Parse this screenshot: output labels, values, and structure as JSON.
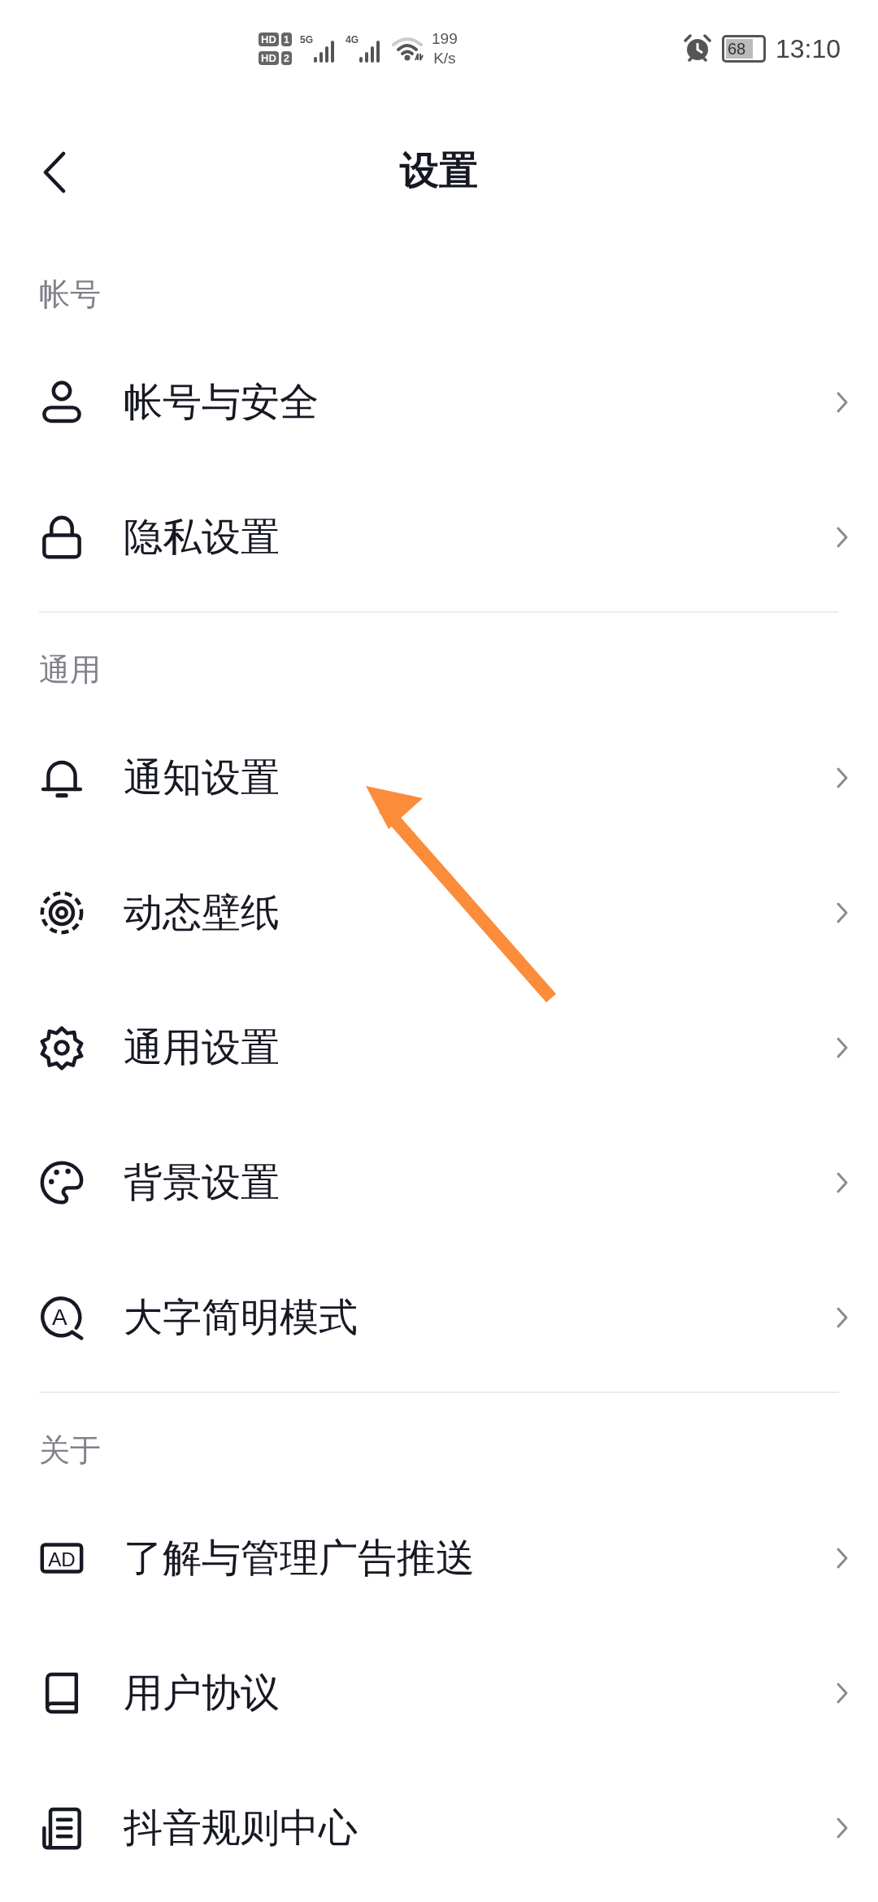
{
  "status_bar": {
    "sim_labels": [
      {
        "label": "HD",
        "slot": "1"
      },
      {
        "label": "HD",
        "slot": "2"
      }
    ],
    "networks": [
      "5G",
      "4G"
    ],
    "speed_value": "199",
    "speed_unit": "K/s",
    "battery": "68",
    "time": "13:10"
  },
  "header": {
    "title": "设置"
  },
  "sections": [
    {
      "title": "帐号",
      "items": [
        {
          "kind": "person",
          "label": "帐号与安全"
        },
        {
          "kind": "lock",
          "label": "隐私设置"
        }
      ]
    },
    {
      "title": "通用",
      "items": [
        {
          "kind": "bell",
          "label": "通知设置"
        },
        {
          "kind": "target",
          "label": "动态壁纸"
        },
        {
          "kind": "gear",
          "label": "通用设置"
        },
        {
          "kind": "palette",
          "label": "背景设置"
        },
        {
          "kind": "letter",
          "icon_text": "A",
          "label": "大字简明模式"
        }
      ]
    },
    {
      "title": "关于",
      "items": [
        {
          "kind": "ad",
          "icon_text": "AD",
          "label": "了解与管理广告推送"
        },
        {
          "kind": "book",
          "label": "用户协议"
        },
        {
          "kind": "document",
          "label": "抖音规则中心"
        }
      ]
    }
  ]
}
